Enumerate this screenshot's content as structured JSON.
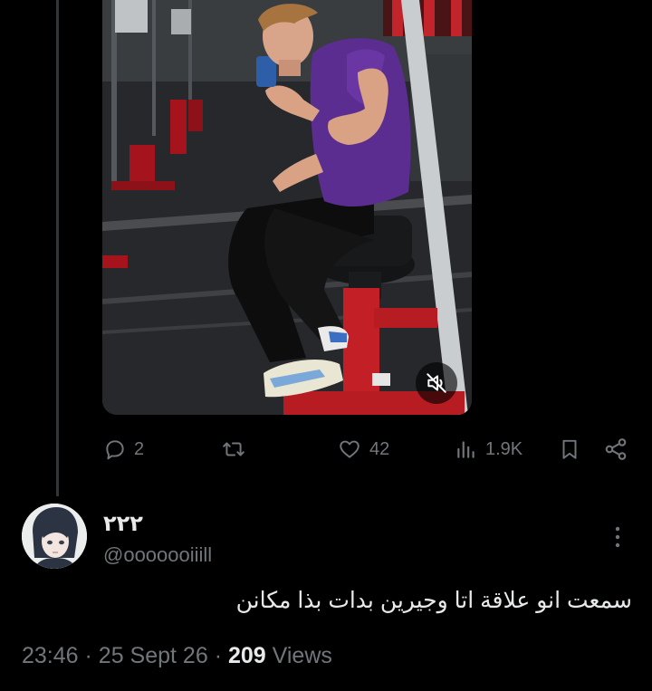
{
  "actions": {
    "reply_count": "2",
    "like_count": "42",
    "views_count": "1.9K"
  },
  "author": {
    "display_name": "٢٢٢",
    "handle": "@ooooooiiill"
  },
  "tweet": {
    "text": "سمعت انو علاقة اتا وجيرين بدات بذا مكانن"
  },
  "meta": {
    "time": "23:46",
    "separator": "·",
    "date": "25 Sept 26",
    "views_number": "209",
    "views_label": "Views"
  },
  "icons": {
    "reply": "reply-icon",
    "retweet": "retweet-icon",
    "like": "heart-icon",
    "views": "views-bar-chart-icon",
    "bookmark": "bookmark-icon",
    "share": "share-icon",
    "mute": "volume-muted-icon",
    "more": "more-vertical-icon"
  },
  "colors": {
    "background": "#000000",
    "text_primary": "#e7e9ea",
    "text_secondary": "#71767b",
    "thread_line": "#333639"
  }
}
